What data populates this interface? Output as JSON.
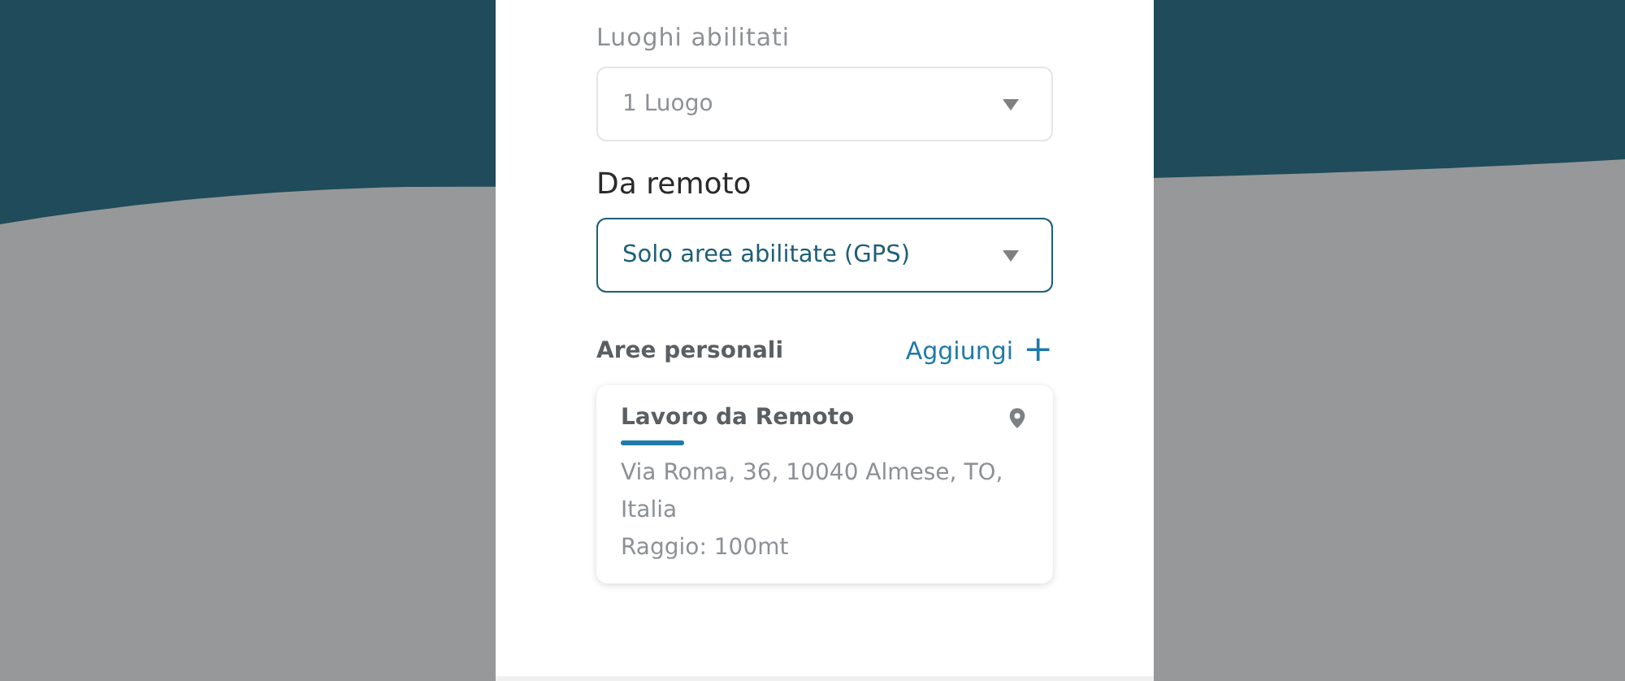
{
  "fields": [
    {
      "label": "Luoghi abilitati",
      "kind": "caption",
      "value": "1 Luogo",
      "active": false
    },
    {
      "label": "Da remoto",
      "kind": "heading",
      "value": "Solo aree abilitate (GPS)",
      "active": true
    }
  ],
  "personal_areas": {
    "title": "Aree personali",
    "add_label": "Aggiungi",
    "add_icon": "+",
    "cards": [
      {
        "title": "Lavoro da Remoto",
        "address": "Via Roma, 36, 10040 Almese, TO, Italia",
        "radius": "Raggio: 100mt"
      }
    ]
  }
}
